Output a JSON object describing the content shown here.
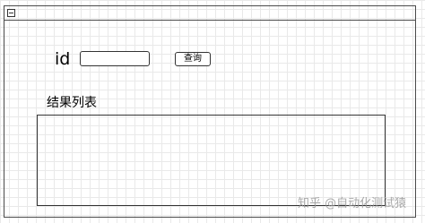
{
  "form": {
    "id_label": "id",
    "id_value": "",
    "query_button_label": "查询",
    "results_label": "结果列表",
    "results": []
  },
  "icons": {
    "titlebar_icon": "window-menu-icon"
  },
  "watermark": "知乎 @自动化测试猿",
  "colors": {
    "border": "#333333",
    "grid": "#e9e9e9",
    "watermark": "#9a9a9a"
  }
}
